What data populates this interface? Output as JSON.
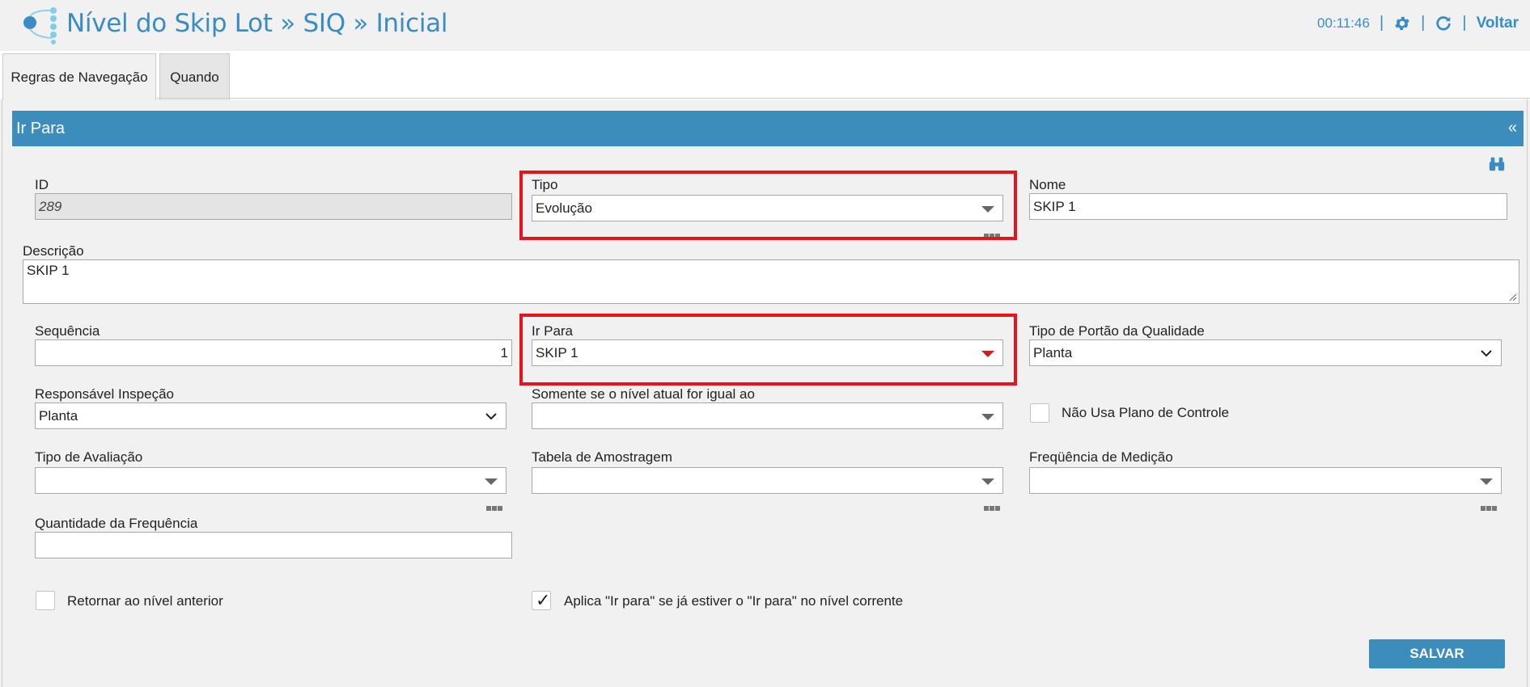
{
  "header": {
    "title": "Nível do Skip Lot » SIQ » Inicial",
    "time": "00:11:46",
    "separator": "|",
    "back_label": "Voltar"
  },
  "tabs": [
    {
      "label": "Regras de Navegação",
      "active": true
    },
    {
      "label": "Quando",
      "active": false
    }
  ],
  "panel": {
    "title": "Ir Para",
    "collapse_glyph": "«"
  },
  "form": {
    "id": {
      "label": "ID",
      "value": "289"
    },
    "tipo": {
      "label": "Tipo",
      "value": "Evolução"
    },
    "nome": {
      "label": "Nome",
      "value": "SKIP 1"
    },
    "descricao": {
      "label": "Descrição",
      "value": "SKIP 1"
    },
    "sequencia": {
      "label": "Sequência",
      "value": "1"
    },
    "ir_para": {
      "label": "Ir Para",
      "value": "SKIP 1"
    },
    "tipo_portao": {
      "label": "Tipo de Portão da Qualidade",
      "value": "Planta"
    },
    "responsavel": {
      "label": "Responsável Inspeção",
      "value": "Planta"
    },
    "somente_nivel": {
      "label": "Somente se o nível atual for igual ao",
      "value": ""
    },
    "nao_usa_plano": {
      "label": "Não Usa Plano de Controle",
      "checked": false
    },
    "tipo_avaliacao": {
      "label": "Tipo de Avaliação",
      "value": ""
    },
    "tabela_amostragem": {
      "label": "Tabela de Amostragem",
      "value": ""
    },
    "frequencia_medicao": {
      "label": "Freqüência de Medição",
      "value": ""
    },
    "quantidade_frequencia": {
      "label": "Quantidade da Frequência",
      "value": ""
    },
    "retornar_nivel": {
      "label": "Retornar ao nível anterior",
      "checked": false
    },
    "aplica_ir_para": {
      "label": "Aplica \"Ir para\" se já estiver o \"Ir para\" no nível corrente",
      "checked": true
    }
  },
  "save_label": "SALVAR",
  "colors": {
    "accent": "#3c8dbc",
    "highlight": "#e8141b"
  }
}
